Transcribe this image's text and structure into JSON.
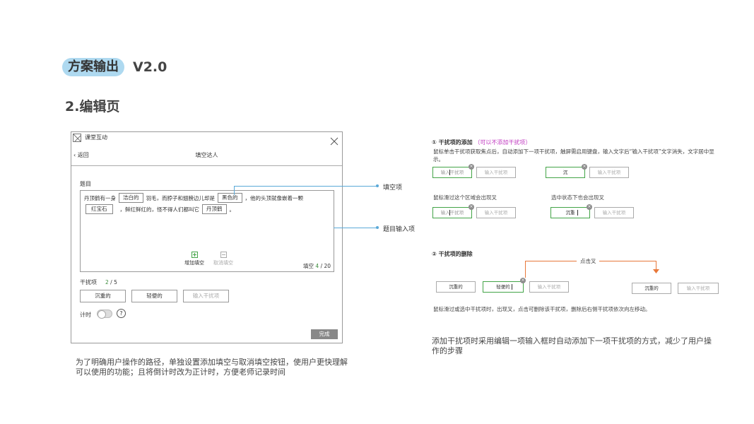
{
  "header": {
    "tag": "方案输出",
    "version": "V2.0",
    "section_title": "2.编辑页"
  },
  "window": {
    "app_title": "课堂互动",
    "back_label": "返回",
    "page_title": "填空达人",
    "question_label": "题目",
    "editor": {
      "line1_a": "丹顶鹤有一身",
      "blank1": "洁白的",
      "line1_b": "羽毛，而脖子和翅膀边儿却是",
      "blank2": "黑色的",
      "line1_c": "，他的头顶就像嵌着一颗",
      "blank3": "红宝石",
      "line2_a": "，鲜红鲜红的，怪不得人们都叫它",
      "blank4": "丹顶鹤",
      "line2_b": "。"
    },
    "add_blank_label": "增加填空",
    "cancel_blank_label": "取消填空",
    "blank_count_label": "填空",
    "blank_count_current": "4",
    "blank_count_total": "/ 20",
    "distractor_label": "干扰项",
    "distractor_count_current": "2",
    "distractor_count_total": "/ 5",
    "distractors": [
      "沉重的",
      "轻便的"
    ],
    "distractor_placeholder": "输入干扰项",
    "timer_label": "计时",
    "help_glyph": "?",
    "done_label": "完成"
  },
  "callouts": {
    "blank_item": "填空项",
    "question_input": "题目输入项"
  },
  "left_note": "为了明确用户操作的路径，单独设置添加填空与取消填空按钮，使用户更快理解可以使用的功能；且将倒计时改为正计时，方便老师记录时间",
  "right_panel": {
    "section1": {
      "num": "①",
      "title": "干扰项的添加",
      "hint": "（可以不添加干扰项）",
      "desc": "鼠标单击干扰项获取焦点后，自动添加下一项干扰项，触屏需启用键盘，输入文字后“输入干扰项”文字消失，文字居中显示。",
      "placeholder": "输入干扰项",
      "typed": "沉",
      "hover_note": "鼠标滑过这个区域会出现叉",
      "select_note": "选中状态下也会出现叉",
      "typed_full": "沉重"
    },
    "section2": {
      "num": "②",
      "title": "干扰项的删除",
      "click_label": "点击叉",
      "item_a": "沉重的",
      "item_b": "轻便的",
      "placeholder": "输入干扰项",
      "desc": "鼠标滑过或选中干扰项时，出现叉，点击可删除该干扰项，删除后右侧干扰项依次向左移动。"
    },
    "note": "添加干扰项时采用编辑一项输入框时自动添加下一项干扰项的方式，减少了用户操作的步骤"
  },
  "colors": {
    "pill": "#aed9f0",
    "accent_green": "#43a447",
    "callout_blue": "#5aa9d8",
    "hint_pink": "#c038c0",
    "arrow_orange": "#e8783a"
  }
}
